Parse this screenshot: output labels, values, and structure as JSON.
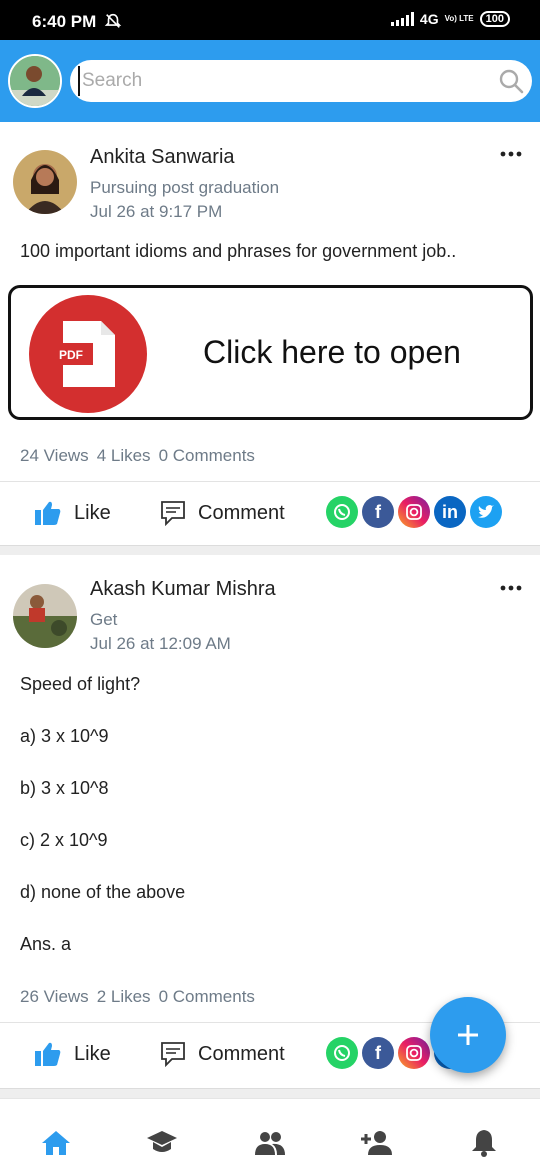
{
  "status_bar": {
    "time": "6:40 PM",
    "network": "4G",
    "carrier": "Vo) LTE",
    "battery": "100"
  },
  "header": {
    "search_placeholder": "Search"
  },
  "posts": [
    {
      "author": "Ankita Sanwaria",
      "subtitle": "Pursuing post graduation",
      "date": "Jul 26 at 9:17 PM",
      "text": "100 important idioms and phrases for government job..",
      "attachment": {
        "icon_label": "PDF",
        "cta": "Click here to open"
      },
      "views": "24 Views",
      "likes": "4 Likes",
      "comments": "0 Comments"
    },
    {
      "author": "Akash Kumar Mishra",
      "subtitle": "Get",
      "date": "Jul 26 at 12:09 AM",
      "lines": [
        "Speed of light?",
        "a) 3 x 10^9",
        "b) 3 x 10^8",
        "c) 2 x 10^9",
        "d) none of the above",
        "Ans. a"
      ],
      "views": "26 Views",
      "likes": "2 Likes",
      "comments": "0 Comments"
    }
  ],
  "actions": {
    "like": "Like",
    "comment": "Comment"
  },
  "share_icons": [
    "whatsapp-icon",
    "facebook-icon",
    "instagram-icon",
    "linkedin-icon",
    "twitter-icon"
  ],
  "bottom_nav": [
    "home-icon",
    "courses-icon",
    "groups-icon",
    "add-friend-icon",
    "notifications-icon"
  ],
  "colors": {
    "accent": "#2d9cee",
    "pdf": "#d32f2f",
    "whatsapp": "#25d366",
    "facebook": "#3b5998",
    "linkedin": "#0a66c2",
    "twitter": "#1da1f2"
  }
}
